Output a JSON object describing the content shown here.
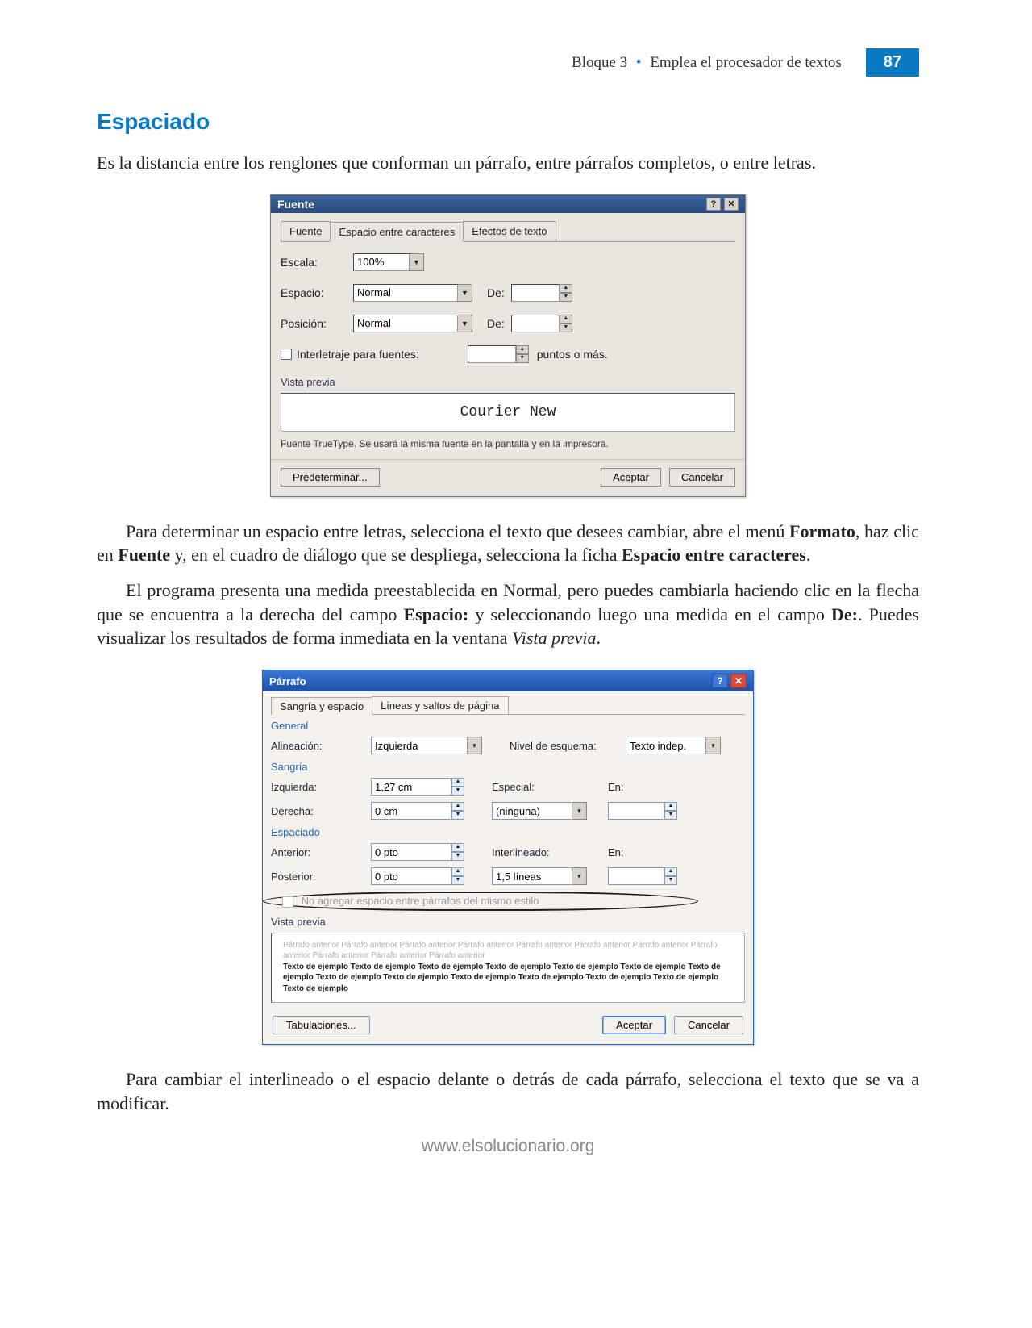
{
  "header": {
    "block_label": "Bloque 3",
    "block_title": "Emplea el procesador de textos",
    "page_number": "87"
  },
  "section_title": "Espaciado",
  "intro_text": "Es la distancia entre los renglones que conforman un párrafo, entre párrafos completos, o entre letras.",
  "dialog1": {
    "title": "Fuente",
    "tabs": [
      "Fuente",
      "Espacio entre caracteres",
      "Efectos de texto"
    ],
    "active_tab_index": 1,
    "fields": {
      "escala_label": "Escala:",
      "escala_value": "100%",
      "espacio_label": "Espacio:",
      "espacio_value": "Normal",
      "espacio_de_label": "De:",
      "espacio_de_value": "",
      "posicion_label": "Posición:",
      "posicion_value": "Normal",
      "posicion_de_label": "De:",
      "posicion_de_value": "",
      "interletraje_label": "Interletraje para fuentes:",
      "interletraje_value": "",
      "interletraje_unit": "puntos o más."
    },
    "preview_label": "Vista previa",
    "preview_text": "Courier New",
    "hint_text": "Fuente TrueType. Se usará la misma fuente en la pantalla y en la impresora.",
    "buttons": {
      "predeterminar": "Predeterminar...",
      "aceptar": "Aceptar",
      "cancelar": "Cancelar"
    }
  },
  "para_after_d1_1": "Para determinar un espacio entre letras, selecciona el texto que desees cambiar, abre el menú Formato, haz clic en Fuente y, en el cuadro de diálogo que se despliega, selecciona la ficha Espacio entre caracteres.",
  "para_after_d1_2": "El programa presenta una medida preestablecida en Normal, pero puedes cambiarla haciendo clic en la flecha que se encuentra a la derecha del campo Espacio: y seleccionando luego una medida en el campo De:. Puedes visualizar los resultados de forma inmediata en la ventana Vista previa.",
  "dialog2": {
    "title": "Párrafo",
    "tabs": [
      "Sangría y espacio",
      "Líneas y saltos de página"
    ],
    "active_tab_index": 0,
    "group_general": {
      "label": "General",
      "alineacion_label": "Alineación:",
      "alineacion_value": "Izquierda",
      "nivel_label": "Nivel de esquema:",
      "nivel_value": "Texto indep."
    },
    "group_sangria": {
      "label": "Sangría",
      "izquierda_label": "Izquierda:",
      "izquierda_value": "1,27 cm",
      "derecha_label": "Derecha:",
      "derecha_value": "0 cm",
      "especial_label": "Especial:",
      "especial_value": "(ninguna)",
      "en_label": "En:",
      "en_value": ""
    },
    "group_espaciado": {
      "label": "Espaciado",
      "anterior_label": "Anterior:",
      "anterior_value": "0 pto",
      "posterior_label": "Posterior:",
      "posterior_value": "0 pto",
      "interlineado_label": "Interlineado:",
      "interlineado_value": "1,5 líneas",
      "en_label": "En:",
      "en_value": "",
      "no_agregar_label": "No agregar espacio entre párrafos del mismo estilo"
    },
    "preview_label": "Vista previa",
    "preview_faint1": "Párrafo anterior Párrafo anterior Párrafo anterior Párrafo anterior Párrafo anterior Párrafo anterior Párrafo anterior Párrafo anterior Párrafo anterior Párrafo anterior Párrafo anterior",
    "preview_bold": "Texto de ejemplo Texto de ejemplo Texto de ejemplo Texto de ejemplo Texto de ejemplo Texto de ejemplo Texto de ejemplo Texto de ejemplo Texto de ejemplo Texto de ejemplo Texto de ejemplo Texto de ejemplo Texto de ejemplo Texto de ejemplo",
    "buttons": {
      "tabulaciones": "Tabulaciones...",
      "aceptar": "Aceptar",
      "cancelar": "Cancelar"
    }
  },
  "para_after_d2": "Para cambiar el interlineado o el espacio delante o detrás de cada párrafo, selecciona el texto que se va a modificar.",
  "footer_url": "www.elsolucionario.org"
}
